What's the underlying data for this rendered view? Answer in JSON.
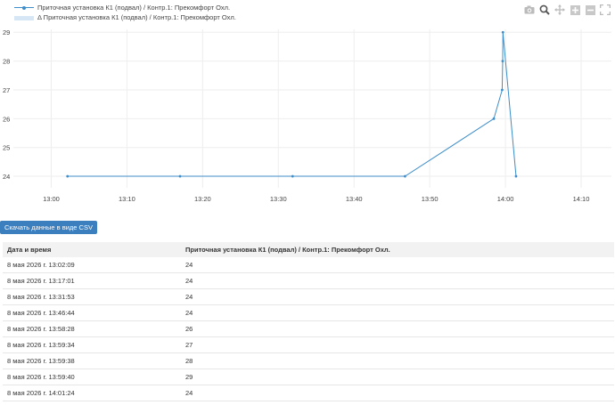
{
  "legend": {
    "series_label": "Приточная установка К1 (подвал) / Контр.1: Прекомфорт Охл.",
    "delta_label": "Δ Приточная установка К1 (подвал) / Контр.1: Прекомфорт Охл."
  },
  "modebar": {
    "icons": [
      "camera-icon",
      "zoom-icon",
      "pan-icon",
      "zoom-in-icon",
      "zoom-out-icon",
      "autoscale-icon"
    ]
  },
  "chart_data": {
    "type": "line",
    "x_ticks": [
      "13:00",
      "13:10",
      "13:20",
      "13:30",
      "13:40",
      "13:50",
      "14:00",
      "14:10"
    ],
    "y_ticks": [
      "24",
      "25",
      "26",
      "27",
      "28",
      "29"
    ],
    "xlim": [
      "12:55:00",
      "14:14:00"
    ],
    "ylim": [
      23.6,
      29.1
    ],
    "grid": true,
    "series_color": "#3c8dc9",
    "series": [
      {
        "name": "Приточная установка К1 (подвал) / Контр.1: Прекомфорт Охл.",
        "x": [
          "13:02:09",
          "13:17:01",
          "13:31:53",
          "13:46:44",
          "13:58:28",
          "13:59:34",
          "13:59:38",
          "13:59:40",
          "14:01:24"
        ],
        "values": [
          24,
          24,
          24,
          24,
          26,
          27,
          28,
          29,
          24
        ]
      }
    ]
  },
  "csv_button": "Скачать данные в виде CSV",
  "table": {
    "headers": [
      "Дата и время",
      "Приточная установка К1 (подвал) / Контр.1: Прекомфорт Охл."
    ],
    "rows": [
      [
        "8 мая 2026 г. 13:02:09",
        "24"
      ],
      [
        "8 мая 2026 г. 13:17:01",
        "24"
      ],
      [
        "8 мая 2026 г. 13:31:53",
        "24"
      ],
      [
        "8 мая 2026 г. 13:46:44",
        "24"
      ],
      [
        "8 мая 2026 г. 13:58:28",
        "26"
      ],
      [
        "8 мая 2026 г. 13:59:34",
        "27"
      ],
      [
        "8 мая 2026 г. 13:59:38",
        "28"
      ],
      [
        "8 мая 2026 г. 13:59:40",
        "29"
      ],
      [
        "8 мая 2026 г. 14:01:24",
        "24"
      ]
    ]
  }
}
